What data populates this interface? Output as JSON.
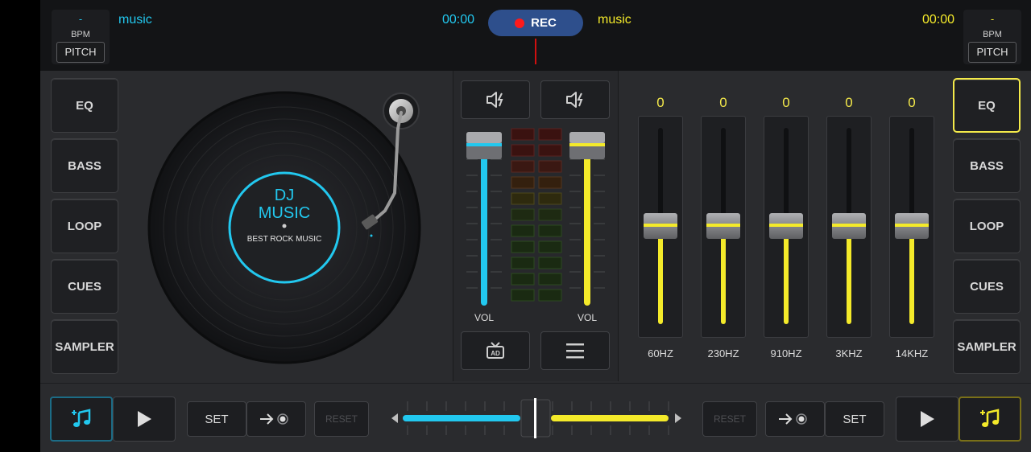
{
  "colors": {
    "cyan": "#22c8ef",
    "yellow": "#f4ea2a",
    "rec": "#2e4f8c",
    "rec_dot": "#ff1a1a"
  },
  "left_deck": {
    "bpm_value": "-",
    "bpm_label": "BPM",
    "pitch_label": "PITCH",
    "track_name": "music",
    "time": "00:00",
    "buttons": [
      "EQ",
      "BASS",
      "LOOP",
      "CUES",
      "SAMPLER"
    ],
    "record_label_line1": "DJ",
    "record_label_line2": "MUSIC",
    "record_sublabel": "BEST ROCK MUSIC",
    "volume_level": 0.95
  },
  "right_deck": {
    "bpm_value": "-",
    "bpm_label": "BPM",
    "pitch_label": "PITCH",
    "track_name": "music",
    "time": "00:00",
    "buttons": [
      "EQ",
      "BASS",
      "LOOP",
      "CUES",
      "SAMPLER"
    ],
    "active_button": "EQ",
    "volume_level": 0.95
  },
  "rec_label": "REC",
  "mixer": {
    "left_vol_label": "VOL",
    "right_vol_label": "VOL",
    "speaker_icon_left": "speaker-icon",
    "speaker_icon_right": "speaker-icon",
    "ad_icon": "ad-icon",
    "menu_icon": "menu-icon"
  },
  "equalizer": {
    "bands": [
      {
        "label": "60HZ",
        "value": "0",
        "level": 0.5
      },
      {
        "label": "230HZ",
        "value": "0",
        "level": 0.5
      },
      {
        "label": "910HZ",
        "value": "0",
        "level": 0.5
      },
      {
        "label": "3KHZ",
        "value": "0",
        "level": 0.5
      },
      {
        "label": "14KHZ",
        "value": "0",
        "level": 0.5
      }
    ]
  },
  "bottom": {
    "left_set": "SET",
    "left_reset": "RESET",
    "right_set": "SET",
    "right_reset": "RESET",
    "crossfader_position": 0.5
  }
}
